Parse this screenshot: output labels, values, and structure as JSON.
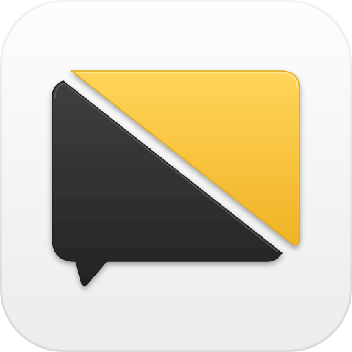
{
  "app_icon": {
    "icon_name": "chat-bubble-icon",
    "colors": {
      "tile_light": "#fbfbfb",
      "tile_shadow": "#e3e3e3",
      "accent_yellow": "#f5bd2f",
      "accent_yellow_light": "#ffd75c",
      "bubble_dark": "#2f2f2f",
      "bubble_dark_light": "#4a4a4a"
    }
  }
}
